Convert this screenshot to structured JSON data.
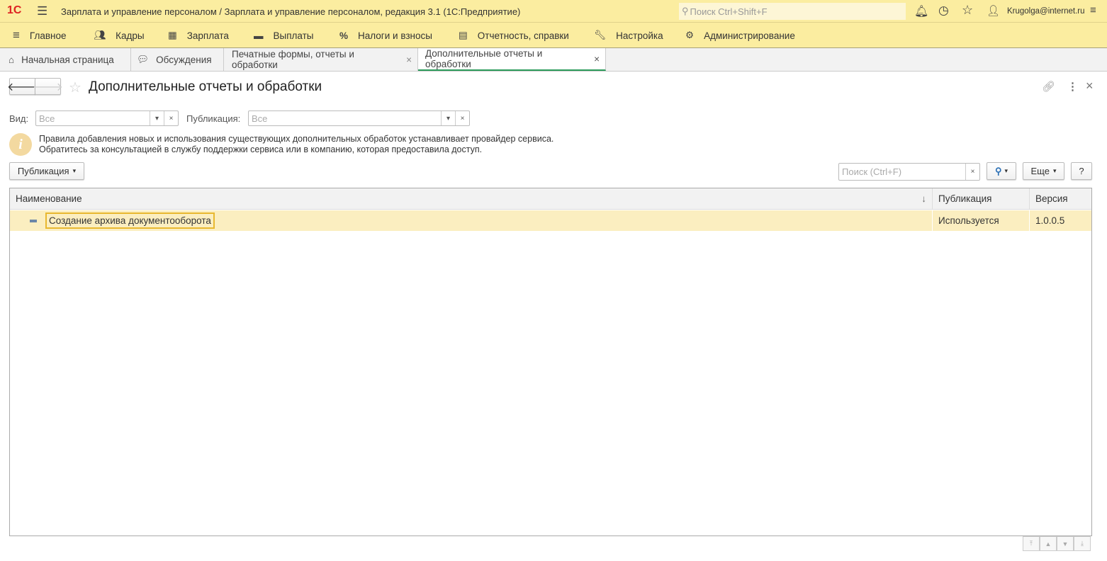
{
  "titlebar": {
    "logo": "1С",
    "title": "Зарплата и управление персоналом / Зарплата и управление персоналом, редакция 3.1  (1С:Предприятие)",
    "search_placeholder": "Поиск Ctrl+Shift+F",
    "user": "Krugolga@internet.ru"
  },
  "menu": [
    {
      "label": "Главное",
      "icon": "menu-icon"
    },
    {
      "label": "Кадры",
      "icon": "people-icon"
    },
    {
      "label": "Зарплата",
      "icon": "calculator-icon"
    },
    {
      "label": "Выплаты",
      "icon": "wallet-icon"
    },
    {
      "label": "Налоги и взносы",
      "icon": "percent-icon"
    },
    {
      "label": "Отчетность, справки",
      "icon": "reports-icon"
    },
    {
      "label": "Настройка",
      "icon": "wrench-icon"
    },
    {
      "label": "Администрирование",
      "icon": "gear-icon"
    }
  ],
  "tabs": [
    {
      "label": "Начальная страница"
    },
    {
      "label": "Обсуждения"
    },
    {
      "label": "Печатные формы, отчеты и обработки"
    },
    {
      "label": "Дополнительные отчеты и обработки"
    }
  ],
  "form": {
    "title": "Дополнительные отчеты и обработки",
    "filter_kind_label": "Вид:",
    "filter_kind_value": "Все",
    "filter_pub_label": "Публикация:",
    "filter_pub_value": "Все",
    "info_line1": "Правила добавления новых и использования существующих дополнительных обработок устанавливает провайдер сервиса.",
    "info_line2": "Обратитесь за консультацией в службу поддержки сервиса или в компанию, которая предоставила доступ.",
    "publication_button": "Публикация",
    "search_placeholder": "Поиск (Ctrl+F)",
    "more_button": "Еще",
    "help_button": "?"
  },
  "table": {
    "columns": [
      "Наименование",
      "Публикация",
      "Версия"
    ],
    "sort_indicator": "↓",
    "rows": [
      {
        "name": "Создание архива документооборота",
        "publication": "Используется",
        "version": "1.0.0.5"
      }
    ]
  }
}
